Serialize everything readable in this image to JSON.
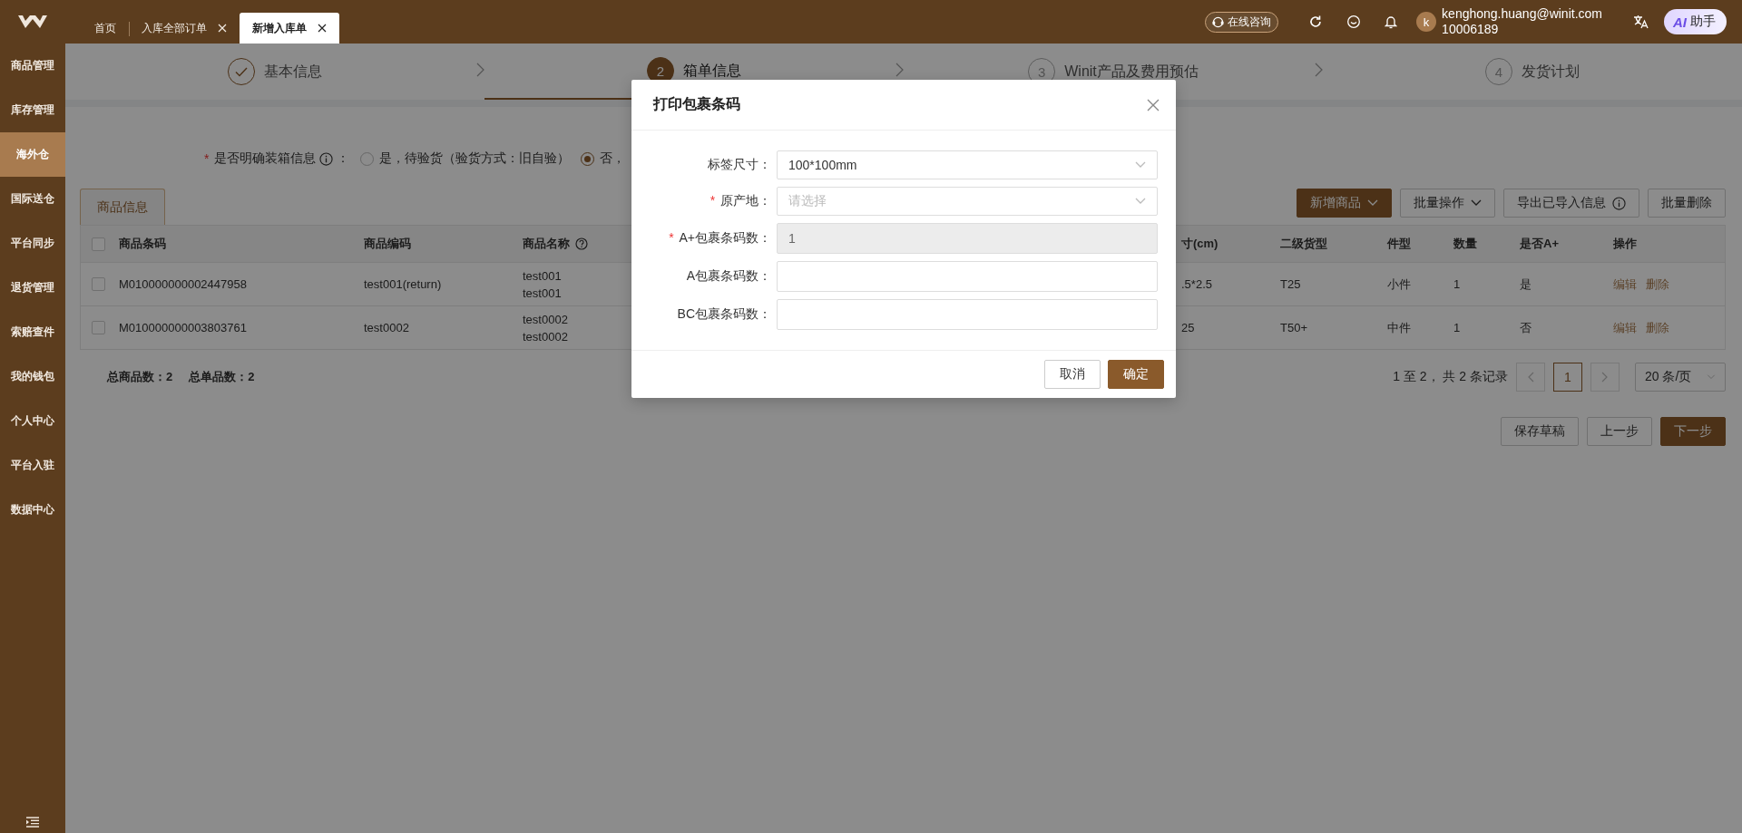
{
  "top_bar": {
    "tabs": [
      {
        "label": "首页",
        "closable": false,
        "selected": false
      },
      {
        "label": "入库全部订单",
        "closable": true,
        "selected": false
      },
      {
        "label": "新增入库单",
        "closable": true,
        "selected": true
      }
    ],
    "consult_button": "在线咨询",
    "user": {
      "avatar": "k",
      "email": "kenghong.huang@winit.com",
      "id": "10006189"
    },
    "assistant_button": {
      "badge": "AI",
      "label": "助手"
    }
  },
  "sidebar": {
    "items": [
      {
        "label": "商品管理",
        "selected": false
      },
      {
        "label": "库存管理",
        "selected": false
      },
      {
        "label": "海外仓",
        "selected": true
      },
      {
        "label": "国际送仓",
        "selected": false
      },
      {
        "label": "平台同步",
        "selected": false
      },
      {
        "label": "退货管理",
        "selected": false
      },
      {
        "label": "索赔查件",
        "selected": false
      },
      {
        "label": "我的钱包",
        "selected": false
      },
      {
        "label": "个人中心",
        "selected": false
      },
      {
        "label": "平台入驻",
        "selected": false
      },
      {
        "label": "数据中心",
        "selected": false
      }
    ]
  },
  "steps": [
    {
      "label": "基本信息",
      "completed": true,
      "selected": false
    },
    {
      "number": "2",
      "label": "箱单信息",
      "completed": false,
      "selected": true
    },
    {
      "number": "3",
      "label": "Winit产品及费用预估",
      "completed": false,
      "selected": false
    },
    {
      "number": "4",
      "label": "发货计划",
      "completed": false,
      "selected": false
    }
  ],
  "packing_question": {
    "required_mark": "*",
    "label": "是否明确装箱信息",
    "colon": "：",
    "options": [
      {
        "label": "是，待验货（验货方式：旧自验）",
        "selected": false
      },
      {
        "label": "否，",
        "selected": true
      }
    ]
  },
  "section_tab": "商品信息",
  "toolbar": [
    {
      "label": "新增商品",
      "kind": "dropdown",
      "primary": true
    },
    {
      "label": "批量操作",
      "kind": "dropdown",
      "primary": false
    },
    {
      "label": "导出已导入信息",
      "kind": "info",
      "primary": false
    },
    {
      "label": "批量删除",
      "kind": "plain",
      "primary": false
    }
  ],
  "table": {
    "header_checked": false,
    "columns": [
      {
        "label": "商品条码",
        "help": false
      },
      {
        "label": "商品编码",
        "help": false
      },
      {
        "label": "商品名称",
        "help": true
      },
      {
        "label": "寸(cm)",
        "help": false
      },
      {
        "label": "二级货型",
        "help": false
      },
      {
        "label": "件型",
        "help": false
      },
      {
        "label": "数量",
        "help": false
      },
      {
        "label": "是否A+",
        "help": false
      },
      {
        "label": "操作",
        "help": false
      }
    ],
    "rows": [
      {
        "checked": false,
        "barcode": "M010000000002447958",
        "code": "test001(return)",
        "name": [
          "test001",
          "test001"
        ],
        "size": ".5*2.5",
        "cargo_type": "T25",
        "piece_type": "小件",
        "quantity": "1",
        "a_plus": "是",
        "actions": [
          "编辑",
          "删除"
        ]
      },
      {
        "checked": false,
        "barcode": "M010000000003803761",
        "code": "test0002",
        "name": [
          "test0002",
          "test0002"
        ],
        "size": "25",
        "cargo_type": "T50+",
        "piece_type": "中件",
        "quantity": "1",
        "a_plus": "否",
        "actions": [
          "编辑",
          "删除"
        ]
      }
    ]
  },
  "totals": [
    "总商品数：2",
    "总单品数：2"
  ],
  "pagination": {
    "summary": "1 至 2， 共 2 条记录",
    "pages": [
      {
        "label": "1",
        "selected": true
      }
    ],
    "page_size": "20 条/页"
  },
  "footer_buttons": [
    {
      "label": "保存草稿",
      "primary": false
    },
    {
      "label": "上一步",
      "primary": false
    },
    {
      "label": "下一步",
      "primary": true
    }
  ],
  "dialog": {
    "title": "打印包裹条码",
    "fields": [
      {
        "label": "标签尺寸：",
        "kind": "select",
        "value": "100*100mm",
        "disabled": false
      },
      {
        "label": "原产地：",
        "required_mark": "*",
        "kind": "select",
        "placeholder": "请选择",
        "disabled": false
      },
      {
        "label": "A+包裹条码数：",
        "required_mark": "*",
        "kind": "input",
        "value": "1",
        "disabled": true
      },
      {
        "label": "A包裹条码数：",
        "kind": "input",
        "disabled": false
      },
      {
        "label": "BC包裹条码数：",
        "kind": "input",
        "disabled": false
      }
    ],
    "buttons": [
      {
        "label": "取消",
        "primary": false
      },
      {
        "label": "确定",
        "primary": true
      }
    ]
  }
}
